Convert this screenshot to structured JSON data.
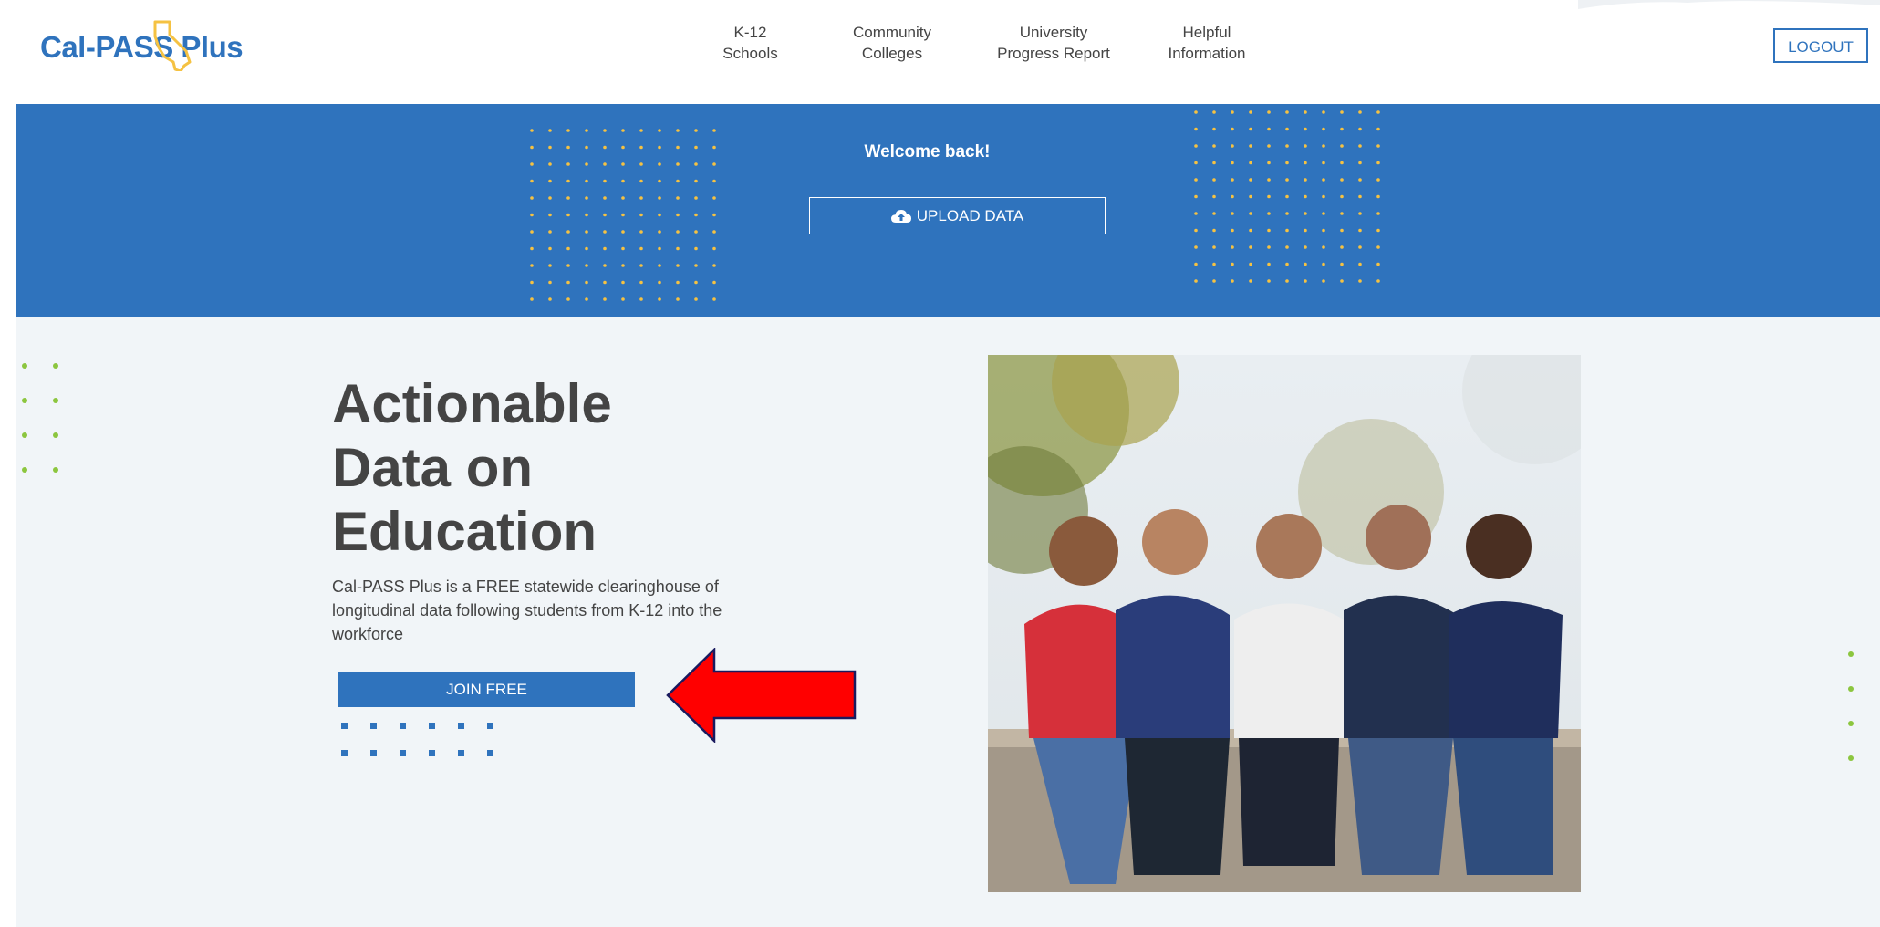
{
  "brand": {
    "name": "Cal-PASS Plus",
    "color": "#2f73bd",
    "accent_yellow": "#f5c242",
    "accent_green": "#8cc63f"
  },
  "nav": [
    {
      "line1": "K-12",
      "line2": "Schools"
    },
    {
      "line1": "Community",
      "line2": "Colleges"
    },
    {
      "line1": "University",
      "line2": "Progress Report"
    },
    {
      "line1": "Helpful",
      "line2": "Information"
    }
  ],
  "header": {
    "logout_label": "LOGOUT"
  },
  "banner": {
    "welcome": "Welcome back!",
    "upload_label": "UPLOAD DATA",
    "upload_icon": "cloud-upload-icon"
  },
  "hero": {
    "headline": [
      "Actionable",
      "Data on",
      "Education"
    ],
    "description": "Cal-PASS Plus is a FREE statewide clearinghouse of longitudinal data following students from K-12 into the workforce",
    "join_label": "JOIN FREE"
  },
  "annotation": {
    "arrow_color": "#ff0000",
    "arrow_icon": "arrow-left-icon"
  },
  "photo": {
    "subject": "five-students-sitting-photo"
  }
}
